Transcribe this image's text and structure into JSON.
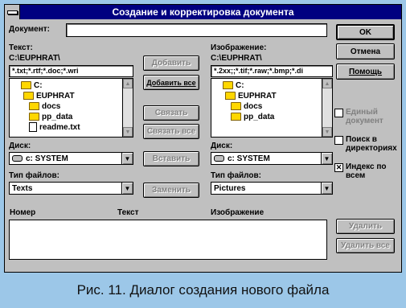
{
  "window": {
    "title": "Создание и корректировка документа"
  },
  "document": {
    "label": "Документ:",
    "value": ""
  },
  "text_panel": {
    "label": "Текст:",
    "path": "C:\\EUPHRAT\\",
    "filter": "*.txt;*.rtf;*.doc;*.wri",
    "tree": [
      {
        "icon": "folder-open-icon",
        "label": "C:"
      },
      {
        "icon": "folder-open-icon",
        "label": "EUPHRAT"
      },
      {
        "icon": "folder-icon",
        "label": "docs"
      },
      {
        "icon": "folder-icon",
        "label": "pp_data"
      },
      {
        "icon": "file-icon",
        "label": "readme.txt"
      }
    ],
    "disk_label": "Диск:",
    "disk_value": "c: SYSTEM",
    "filetype_label": "Тип файлов:",
    "filetype_value": "Texts"
  },
  "image_panel": {
    "label": "Изображение:",
    "path": "C:\\EUPHRAT\\",
    "filter": "*.2xx;;*.tif;*.raw;*.bmp;*.di",
    "tree": [
      {
        "icon": "folder-open-icon",
        "label": "C:"
      },
      {
        "icon": "folder-open-icon",
        "label": "EUPHRAT"
      },
      {
        "icon": "folder-icon",
        "label": "docs"
      },
      {
        "icon": "folder-icon",
        "label": "pp_data"
      }
    ],
    "disk_label": "Диск:",
    "disk_value": "c: SYSTEM",
    "filetype_label": "Тип файлов:",
    "filetype_value": "Pictures"
  },
  "middle_buttons": {
    "add": "Добавить",
    "add_all": "Добавить все",
    "link": "Связать",
    "link_all": "Связать все",
    "insert": "Вставить",
    "replace": "Заменить"
  },
  "right_buttons": {
    "ok": "OK",
    "cancel": "Отмена",
    "help": "Помощь"
  },
  "options": {
    "single_doc": "Единый документ",
    "search_dirs": "Поиск в директориях",
    "index_all": "Индекс по всем",
    "index_checked_mark": "✕"
  },
  "bottom": {
    "col_number": "Номер",
    "col_text": "Текст",
    "col_image": "Изображение",
    "delete": "Удалить",
    "delete_all": "Удалить все"
  },
  "caption": "Рис. 11. Диалог создания нового файла"
}
